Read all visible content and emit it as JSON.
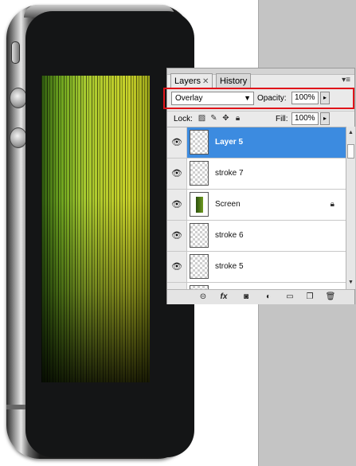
{
  "phone": {
    "screen_accent": "#a6c930"
  },
  "panel": {
    "tabs": [
      {
        "label": "Layers",
        "close": "✕",
        "active": true
      },
      {
        "label": "History",
        "active": false
      }
    ],
    "menu_icon": "panel-menu-icon",
    "blend_mode": "Overlay",
    "opacity_label": "Opacity:",
    "opacity_value": "100%",
    "lock_label": "Lock:",
    "fill_label": "Fill:",
    "fill_value": "100%",
    "selection_color": "#3c8be0",
    "highlight_color": "#e0141a",
    "layers": [
      {
        "name": "Layer 5",
        "selected": true,
        "visible": true
      },
      {
        "name": "stroke 7",
        "selected": false,
        "visible": true
      },
      {
        "name": "Screen",
        "selected": false,
        "visible": true,
        "locked": true
      },
      {
        "name": "stroke 6",
        "selected": false,
        "visible": true
      },
      {
        "name": "stroke 5",
        "selected": false,
        "visible": true
      }
    ],
    "bottom_icons": [
      "link-layers-icon",
      "fx-icon",
      "layer-mask-icon",
      "adjustment-layer-icon",
      "new-group-icon",
      "new-layer-icon",
      "trash-icon"
    ]
  }
}
